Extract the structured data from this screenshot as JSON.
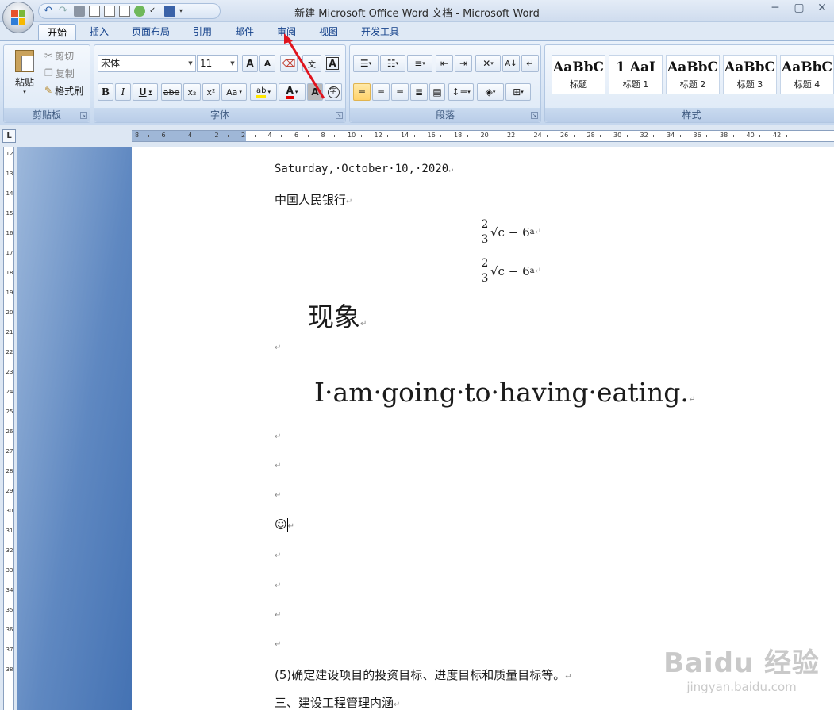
{
  "window": {
    "title": "新建 Microsoft Office Word 文档 - Microsoft Word"
  },
  "tabs": [
    "开始",
    "插入",
    "页面布局",
    "引用",
    "邮件",
    "审阅",
    "视图",
    "开发工具"
  ],
  "active_tab": "开始",
  "clipboard": {
    "paste": "粘贴",
    "cut": "剪切",
    "copy": "复制",
    "format_painter": "格式刷",
    "label": "剪贴板"
  },
  "font": {
    "name": "宋体",
    "size": "11",
    "label": "字体",
    "bold": "B",
    "italic": "I",
    "underline": "U",
    "strike": "abe",
    "sub": "x₂",
    "sup": "x²",
    "case": "Aa",
    "grow": "A",
    "shrink": "A",
    "char_shade": "A"
  },
  "paragraph": {
    "label": "段落"
  },
  "styles": {
    "label": "样式",
    "items": [
      {
        "sample": "AaBbC",
        "name": "标题"
      },
      {
        "sample": "1  AaI",
        "name": "标题 1"
      },
      {
        "sample": "AaBbC",
        "name": "标题 2"
      },
      {
        "sample": "AaBbC",
        "name": "标题 3"
      },
      {
        "sample": "AaBbC",
        "name": "标题 4"
      }
    ]
  },
  "ruler": {
    "h_numbers": [
      "8",
      "6",
      "4",
      "2",
      "2",
      "4",
      "6",
      "8",
      "10",
      "12",
      "14",
      "16",
      "18",
      "20",
      "22",
      "24",
      "26",
      "28",
      "30",
      "32",
      "34",
      "36",
      "38",
      "40",
      "42"
    ],
    "v_numbers": [
      "12",
      "13",
      "14",
      "15",
      "16",
      "17",
      "18",
      "19",
      "20",
      "21",
      "22",
      "23",
      "24",
      "25",
      "26",
      "27",
      "28",
      "29",
      "30",
      "31",
      "32",
      "33",
      "34",
      "35",
      "36",
      "37",
      "38"
    ]
  },
  "document": {
    "date": "Saturday,·October·10,·2020",
    "bank": "中国人民银行",
    "equation_fraction_num": "2",
    "equation_fraction_den": "3",
    "equation_rest": "√c − 6",
    "equation_sup": "a",
    "heading_cn": "现象",
    "english_line": "I·am·going·to·having·eating.",
    "smiley": "☺",
    "paragraph_5": "(5)确定建设项目的投资目标、进度目标和质量目标等。",
    "section_3": "三、建设工程管理内涵",
    "para_mark": "↵"
  },
  "watermark": {
    "main": "Baidu 经验",
    "sub": "jingyan.baidu.com"
  },
  "colors": {
    "accent": "#15428b",
    "arrow": "#e0141e",
    "highlight": "#ffe600",
    "font_color": "#e00000"
  }
}
